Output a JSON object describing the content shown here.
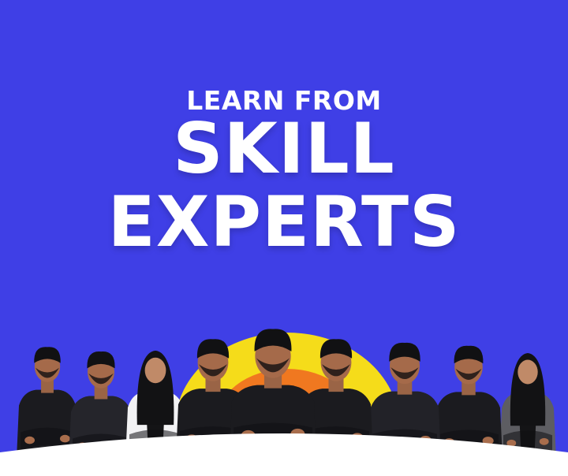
{
  "headline": {
    "line1": "LEARN FROM",
    "line2": "SKILL",
    "line3": "EXPERTS"
  },
  "colors": {
    "background": "#3f3fe6",
    "sun_yellow": "#f5dc1a",
    "sun_orange": "#f07820",
    "sun_red": "#e8412d",
    "headline_text": "#ffffff",
    "bottom_curve": "#ffffff"
  },
  "people": [
    {
      "name": "person-1",
      "outfit": "black-shirt",
      "headwear": "none"
    },
    {
      "name": "person-2",
      "outfit": "black-striped-shirt",
      "headwear": "none"
    },
    {
      "name": "person-3",
      "outfit": "white-coat",
      "headwear": "black-hijab"
    },
    {
      "name": "person-4",
      "outfit": "black-shirt",
      "headwear": "none"
    },
    {
      "name": "person-5",
      "outfit": "black-shirt",
      "headwear": "none"
    },
    {
      "name": "person-6",
      "outfit": "black-shirt",
      "headwear": "none"
    },
    {
      "name": "person-7",
      "outfit": "black-checked-shirt",
      "headwear": "none"
    },
    {
      "name": "person-8",
      "outfit": "black-shirt",
      "headwear": "none"
    },
    {
      "name": "person-9",
      "outfit": "grey-blazer",
      "headwear": "black-hijab"
    }
  ]
}
